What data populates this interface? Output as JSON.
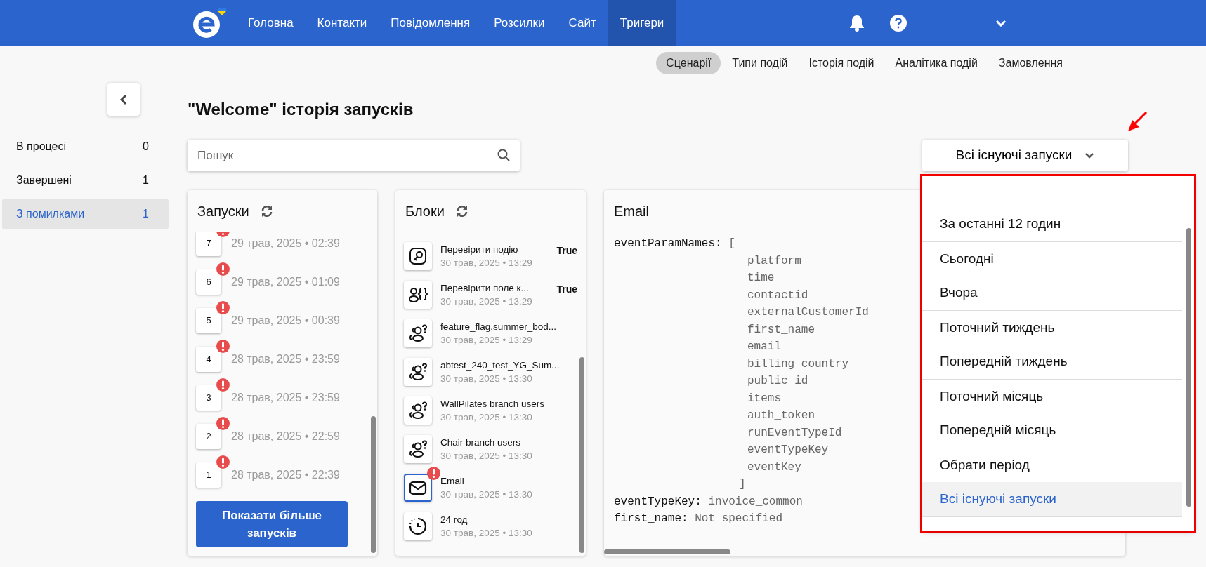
{
  "navbar": {
    "items": [
      {
        "label": "Головна",
        "selected": false
      },
      {
        "label": "Контакти",
        "selected": false
      },
      {
        "label": "Повідомлення",
        "selected": false
      },
      {
        "label": "Розсилки",
        "selected": false
      },
      {
        "label": "Сайт",
        "selected": false
      },
      {
        "label": "Тригери",
        "selected": true
      }
    ]
  },
  "subnav": [
    {
      "label": "Сценарії",
      "selected": true
    },
    {
      "label": "Типи подій",
      "selected": false
    },
    {
      "label": "Історія подій",
      "selected": false
    },
    {
      "label": "Аналітика подій",
      "selected": false
    },
    {
      "label": "Замовлення",
      "selected": false
    }
  ],
  "sidebar": {
    "items": [
      {
        "label": "В процесі",
        "count": "0",
        "selected": false
      },
      {
        "label": "Завершені",
        "count": "1",
        "selected": false
      },
      {
        "label": "З помилками",
        "count": "1",
        "selected": true
      }
    ]
  },
  "title": "\"Welcome\" історія запусків",
  "search": {
    "placeholder": "Пошук"
  },
  "filter": {
    "value": "Всі існуючі запуски",
    "expanded": true,
    "groups": [
      [
        {
          "label": "За останні 12 годин",
          "selected": false
        }
      ],
      [
        {
          "label": "Сьогодні",
          "selected": false
        },
        {
          "label": "Вчора",
          "selected": false
        }
      ],
      [
        {
          "label": "Поточний тиждень",
          "selected": false
        },
        {
          "label": "Попередній тиждень",
          "selected": false
        }
      ],
      [
        {
          "label": "Поточний місяць",
          "selected": false
        },
        {
          "label": "Попередній місяць",
          "selected": false
        }
      ],
      [
        {
          "label": "Обрати період",
          "selected": false
        },
        {
          "label": "Всі існуючі запуски",
          "selected": true
        }
      ]
    ]
  },
  "runs": {
    "title": "Запуски",
    "items": [
      {
        "number": "7",
        "date": "29 трав, 2025 • 02:39",
        "error": true
      },
      {
        "number": "6",
        "date": "29 трав, 2025 • 01:09",
        "error": true
      },
      {
        "number": "5",
        "date": "29 трав, 2025 • 00:39",
        "error": true
      },
      {
        "number": "4",
        "date": "28 трав, 2025 • 23:59",
        "error": true
      },
      {
        "number": "3",
        "date": "28 трав, 2025 • 23:59",
        "error": true
      },
      {
        "number": "2",
        "date": "28 трав, 2025 • 22:59",
        "error": true
      },
      {
        "number": "1",
        "date": "28 трав, 2025 • 22:39",
        "error": true
      }
    ],
    "more_button": "Показати більше запусків"
  },
  "blocks": {
    "title": "Блоки",
    "items": [
      {
        "kind": "event",
        "name": "Перевірити подію",
        "date": "30 трав, 2025 • 13:29",
        "result": "True",
        "error": false,
        "selected": false
      },
      {
        "kind": "field",
        "name": "Перевірити поле к...",
        "date": "30 трав, 2025 • 13:29",
        "result": "True",
        "error": false,
        "selected": false
      },
      {
        "kind": "split",
        "name": "feature_flag.summer_bod...",
        "date": "30 трав, 2025 • 13:29",
        "error": false,
        "selected": false
      },
      {
        "kind": "split",
        "name": "abtest_240_test_YG_Sum...",
        "date": "30 трав, 2025 • 13:30",
        "error": false,
        "selected": false
      },
      {
        "kind": "split",
        "name": "WallPilates branch users",
        "date": "30 трав, 2025 • 13:30",
        "error": false,
        "selected": false
      },
      {
        "kind": "split",
        "name": "Chair branch users",
        "date": "30 трав, 2025 • 13:30",
        "error": false,
        "selected": false
      },
      {
        "kind": "email",
        "name": "Email",
        "date": "30 трав, 2025 • 13:30",
        "error": true,
        "selected": true
      },
      {
        "kind": "delay",
        "name": "24 год",
        "date": "30 трав, 2025 • 13:30",
        "error": false,
        "selected": false
      }
    ]
  },
  "detail": {
    "title": "Email",
    "fields": [
      {
        "kind": "list",
        "key": "eventParamNames:",
        "open": "[",
        "close": "]",
        "values": [
          "platform",
          "time",
          "contactid",
          "externalCustomerId",
          "first_name",
          "email",
          "billing_country",
          "public_id",
          "items",
          "auth_token",
          "runEventTypeId",
          "eventTypeKey",
          "eventKey"
        ]
      },
      {
        "kind": "scalar",
        "key": "eventTypeKey:",
        "value": "invoice_common"
      },
      {
        "kind": "scalar",
        "key": "first_name:",
        "value": "Not specified"
      }
    ]
  }
}
